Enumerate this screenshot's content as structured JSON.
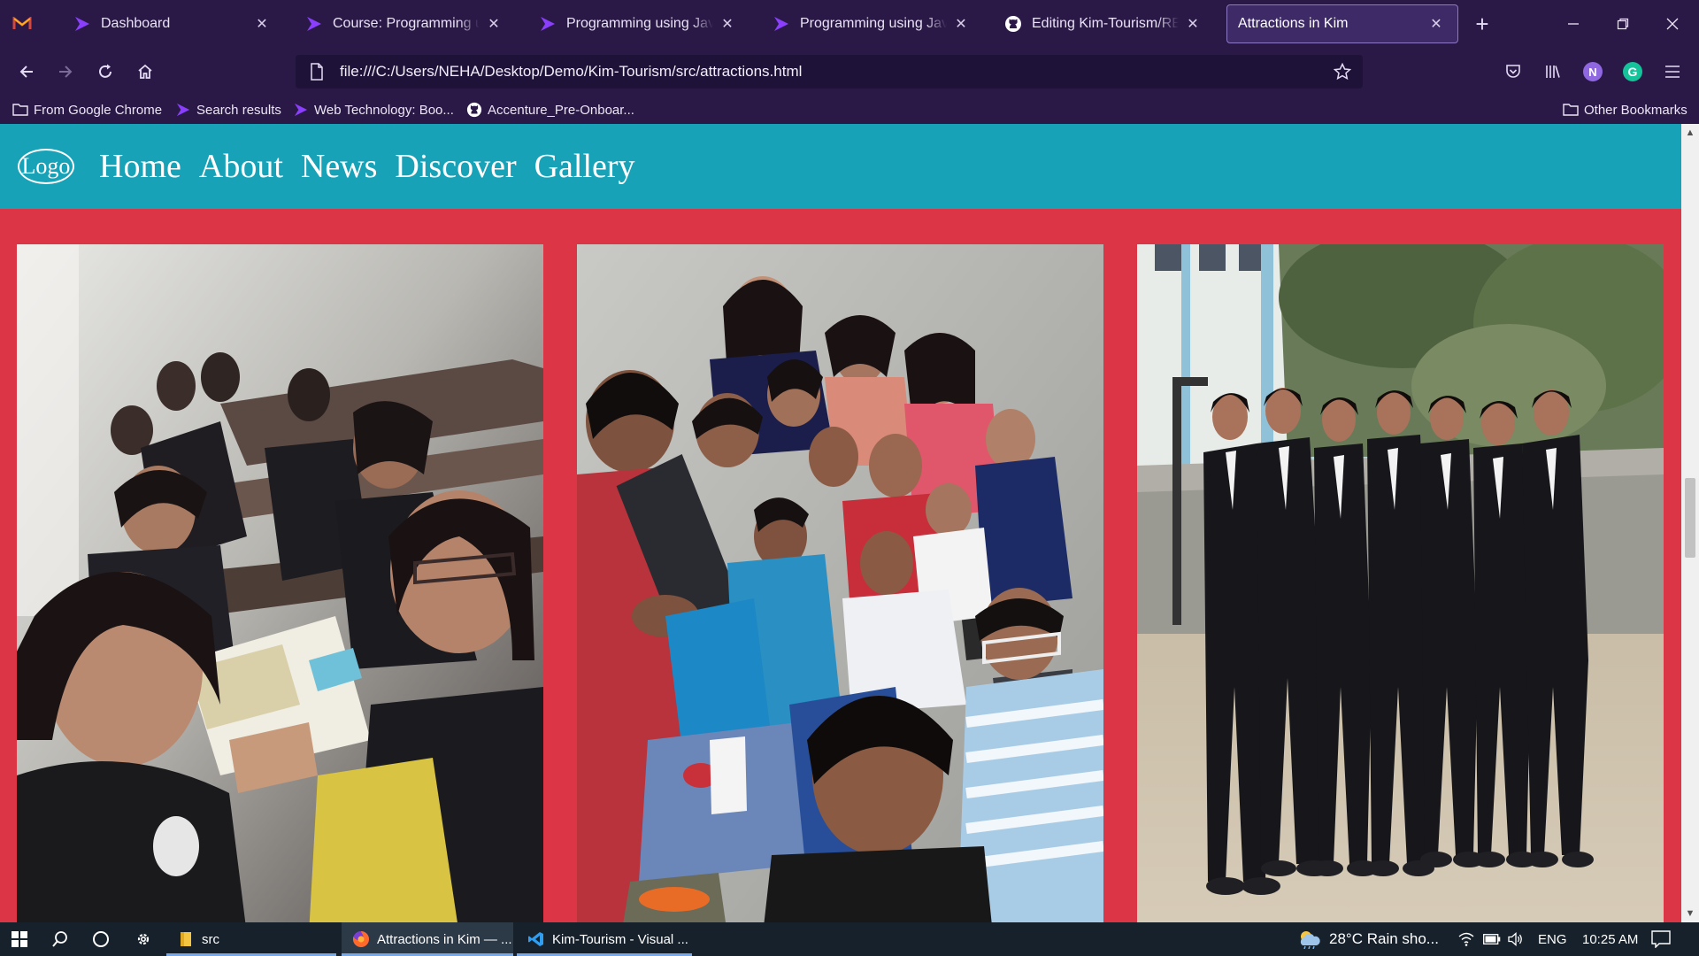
{
  "browser": {
    "tabs": [
      {
        "title": "Dashboard",
        "icon": "proton-arrow-icon"
      },
      {
        "title": "Course: Programming using Java",
        "icon": "proton-arrow-icon"
      },
      {
        "title": "Programming using Java Con",
        "icon": "proton-arrow-icon"
      },
      {
        "title": "Programming using Java Mo",
        "icon": "proton-arrow-icon"
      },
      {
        "title": "Editing Kim-Tourism/README",
        "icon": "github-icon"
      },
      {
        "title": "Attractions in Kim",
        "icon": "none",
        "active": true
      }
    ],
    "new_tab_label": "+",
    "url": "file:///C:/Users/NEHA/Desktop/Demo/Kim-Tourism/src/attractions.html",
    "profile_initial": "N",
    "grammarly_initial": "G",
    "bookmarks": [
      {
        "label": "From Google Chrome",
        "icon": "folder-icon"
      },
      {
        "label": "Search results",
        "icon": "proton-arrow-icon"
      },
      {
        "label": "Web Technology: Boo...",
        "icon": "proton-arrow-icon"
      },
      {
        "label": "Accenture_Pre-Onboar...",
        "icon": "github-icon"
      }
    ],
    "other_bookmarks": "Other Bookmarks"
  },
  "site": {
    "logo": "Logo",
    "nav": [
      "Home",
      "About",
      "News",
      "Discover",
      "Gallery"
    ],
    "colors": {
      "navbar": "#17a2b8",
      "background": "#dc3545"
    },
    "photos": [
      {
        "subject": "students-classroom-selfie"
      },
      {
        "subject": "group-selfie"
      },
      {
        "subject": "students-in-blazers-outdoors"
      }
    ]
  },
  "taskbar": {
    "apps": [
      {
        "label": "src",
        "icon": "file-explorer-icon"
      },
      {
        "label": "Attractions in Kim — ...",
        "icon": "firefox-icon",
        "active": true
      },
      {
        "label": "Kim-Tourism - Visual ...",
        "icon": "vscode-icon"
      }
    ],
    "weather": "28°C  Rain sho...",
    "language": "ENG",
    "time": "10:25 AM"
  }
}
